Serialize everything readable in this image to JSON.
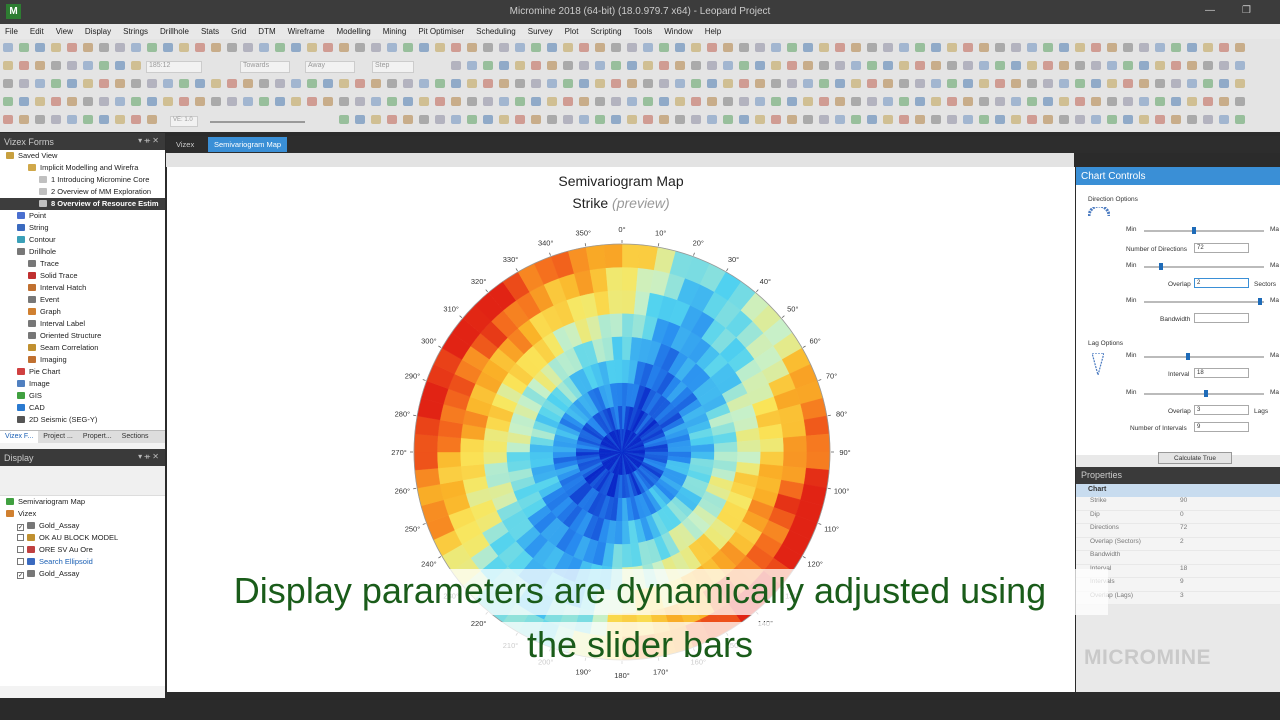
{
  "app": {
    "logo": "M",
    "title": "Micromine 2018 (64-bit) (18.0.979.7 x64) - Leopard Project",
    "window_controls": [
      "—",
      "❐"
    ]
  },
  "menu": [
    "File",
    "Edit",
    "View",
    "Display",
    "Strings",
    "Drillhole",
    "Stats",
    "Grid",
    "DTM",
    "Wireframe",
    "Modelling",
    "Mining",
    "Pit Optimiser",
    "Scheduling",
    "Survey",
    "Plot",
    "Scripting",
    "Tools",
    "Window",
    "Help"
  ],
  "toolbar": {
    "field_1": "185:12",
    "field_2": "Towards",
    "field_3": "Away",
    "field_4": "Step",
    "field_5": "VE: 1.0"
  },
  "vizex_forms": {
    "title": "Vizex Forms",
    "controls": "▾ ᚑ ✕",
    "tree": [
      {
        "label": "Saved View",
        "indent": 0,
        "color": "#c8a040"
      },
      {
        "label": "Implicit Modelling and Wirefra",
        "indent": 2,
        "color": "#d0a84a"
      },
      {
        "label": "1 Introducing Micromine Core",
        "indent": 3,
        "color": "#c0c0c0"
      },
      {
        "label": "2 Overview of MM Exploration",
        "indent": 3,
        "color": "#c0c0c0"
      },
      {
        "label": "8 Overview of Resource Estim",
        "indent": 3,
        "color": "#c0c0c0",
        "selected": true
      },
      {
        "label": "Point",
        "indent": 1,
        "color": "#4a6fd0"
      },
      {
        "label": "String",
        "indent": 1,
        "color": "#3a6abf"
      },
      {
        "label": "Contour",
        "indent": 1,
        "color": "#3aa0b8"
      },
      {
        "label": "Drillhole",
        "indent": 1,
        "color": "#777777"
      },
      {
        "label": "Trace",
        "indent": 2,
        "color": "#777777"
      },
      {
        "label": "Solid Trace",
        "indent": 2,
        "color": "#c03030"
      },
      {
        "label": "Interval Hatch",
        "indent": 2,
        "color": "#c07030"
      },
      {
        "label": "Event",
        "indent": 2,
        "color": "#777777"
      },
      {
        "label": "Graph",
        "indent": 2,
        "color": "#d08030"
      },
      {
        "label": "Interval Label",
        "indent": 2,
        "color": "#777777"
      },
      {
        "label": "Oriented Structure",
        "indent": 2,
        "color": "#777777"
      },
      {
        "label": "Seam Correlation",
        "indent": 2,
        "color": "#c09030"
      },
      {
        "label": "Imaging",
        "indent": 2,
        "color": "#c07030"
      },
      {
        "label": "Pie Chart",
        "indent": 1,
        "color": "#d04040"
      },
      {
        "label": "Image",
        "indent": 1,
        "color": "#5080c0"
      },
      {
        "label": "GIS",
        "indent": 1,
        "color": "#40a040"
      },
      {
        "label": "CAD",
        "indent": 1,
        "color": "#2a7ad0"
      },
      {
        "label": "2D Seismic (SEG-Y)",
        "indent": 1,
        "color": "#555555"
      }
    ],
    "tabs": [
      "Vizex F...",
      "Project ...",
      "Propert...",
      "Sections"
    ]
  },
  "display": {
    "title": "Display",
    "controls": "▾ ᚑ ✕",
    "tree": [
      {
        "label": "Semivariogram Map",
        "indent": 0,
        "check": false,
        "color": "#40a040"
      },
      {
        "label": "Vizex",
        "indent": 0,
        "check": false,
        "color": "#d08030"
      },
      {
        "label": "Gold_Assay",
        "indent": 1,
        "check": true,
        "color": "#777777"
      },
      {
        "label": "OK AU BLOCK MODEL",
        "indent": 1,
        "check": false,
        "color": "#c09030"
      },
      {
        "label": "ORE SV Au Ore",
        "indent": 1,
        "check": false,
        "color": "#c04040"
      },
      {
        "label": "Search Ellipsoid",
        "indent": 1,
        "check": false,
        "color": "#3a6abf",
        "blue": true
      },
      {
        "label": "Gold_Assay",
        "indent": 1,
        "check": true,
        "color": "#777777"
      }
    ]
  },
  "doc_tabs": [
    "Vizex",
    "Semivariogram Map"
  ],
  "chart": {
    "title": "Semivariogram Map",
    "subtitle": "Strike",
    "preview": "(preview)",
    "angle_labels": [
      "0°",
      "10°",
      "20°",
      "30°",
      "40°",
      "50°",
      "60°",
      "70°",
      "80°",
      "90°",
      "100°",
      "110°",
      "120°",
      "130°",
      "140°",
      "150°",
      "160°",
      "170°",
      "180°",
      "190°",
      "200°",
      "210°",
      "220°",
      "230°",
      "240°",
      "250°",
      "260°",
      "270°",
      "280°",
      "290°",
      "300°",
      "310°",
      "320°",
      "330°",
      "340°",
      "350°"
    ]
  },
  "chart_controls": {
    "title": "Chart Controls",
    "direction_options": "Direction Options",
    "lag_options": "Lag Options",
    "min": "Min",
    "max": "Ma",
    "number_of_directions_label": "Number of Directions",
    "number_of_directions": "72",
    "overlap_label": "Overlap",
    "overlap_value": "2",
    "sectors": "Sectors",
    "bandwidth_label": "Bandwidth",
    "bandwidth_value": "",
    "interval_label": "Interval",
    "interval_value": "18",
    "lag_overlap_label": "Overlap",
    "lag_overlap_value": "3",
    "lags": "Lags",
    "number_of_intervals_label": "Number of Intervals",
    "number_of_intervals": "9",
    "calculate_button": "Calculate True",
    "slider_positions": [
      0.41,
      0.13,
      0.98,
      0.36,
      0.52
    ]
  },
  "properties": {
    "title": "Properties",
    "group": "Chart",
    "rows": [
      {
        "k": "Strike",
        "v": "90"
      },
      {
        "k": "Dip",
        "v": "0"
      },
      {
        "k": "Directions",
        "v": "72"
      },
      {
        "k": "Overlap (Sectors)",
        "v": "2"
      },
      {
        "k": "Bandwidth",
        "v": ""
      },
      {
        "k": "Interval",
        "v": "18"
      },
      {
        "k": "Intervals",
        "v": "9"
      },
      {
        "k": "Overlap (Lags)",
        "v": "3"
      }
    ]
  },
  "caption": {
    "line1": "Display parameters are dynamically adjusted using",
    "line2": "the slider bars"
  },
  "brand": "MICROMINE",
  "colors": {
    "accent": "#3a8fd6",
    "caption": "#1a5c1a"
  }
}
